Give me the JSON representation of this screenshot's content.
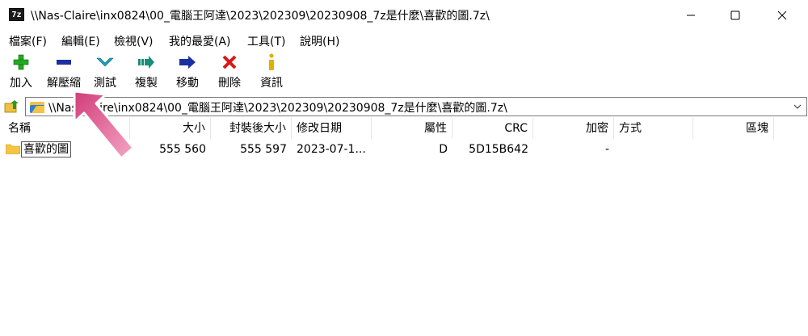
{
  "window": {
    "icon_text": "7z",
    "title": "\\\\Nas-Claire\\inx0824\\00_電腦王阿達\\2023\\202309\\20230908_7z是什麼\\喜歡的圖.7z\\"
  },
  "menu": [
    "檔案(F)",
    "編輯(E)",
    "檢視(V)",
    "我的最愛(A)",
    "工具(T)",
    "說明(H)"
  ],
  "toolbar": {
    "add": "加入",
    "extract": "解壓縮",
    "test": "測試",
    "copy": "複製",
    "move": "移動",
    "delete": "刪除",
    "info": "資訊"
  },
  "address": {
    "path": "\\\\Nas-Claire\\inx0824\\00_電腦王阿達\\2023\\202309\\20230908_7z是什麼\\喜歡的圖.7z\\"
  },
  "columns": {
    "name": "名稱",
    "size": "大小",
    "packed": "封裝後大小",
    "modified": "修改日期",
    "attr": "屬性",
    "crc": "CRC",
    "encrypted": "加密",
    "method": "方式",
    "block": "區塊"
  },
  "files": [
    {
      "name": "喜歡的圖",
      "size": "555 560",
      "packed": "555 597",
      "modified": "2023-07-1...",
      "attr": "D",
      "crc": "5D15B642",
      "encrypted": "-",
      "method": "",
      "block": ""
    }
  ],
  "colors": {
    "add_icon": "#22aa22",
    "extract_icon": "#1a2fa0",
    "test_icon": "#1fa0b8",
    "copy_icon": "#1a8c7a",
    "move_icon": "#1a2fa0",
    "delete_icon": "#d81818",
    "info_icon": "#e0b000",
    "annotation_arrow": "#cc3d78"
  }
}
